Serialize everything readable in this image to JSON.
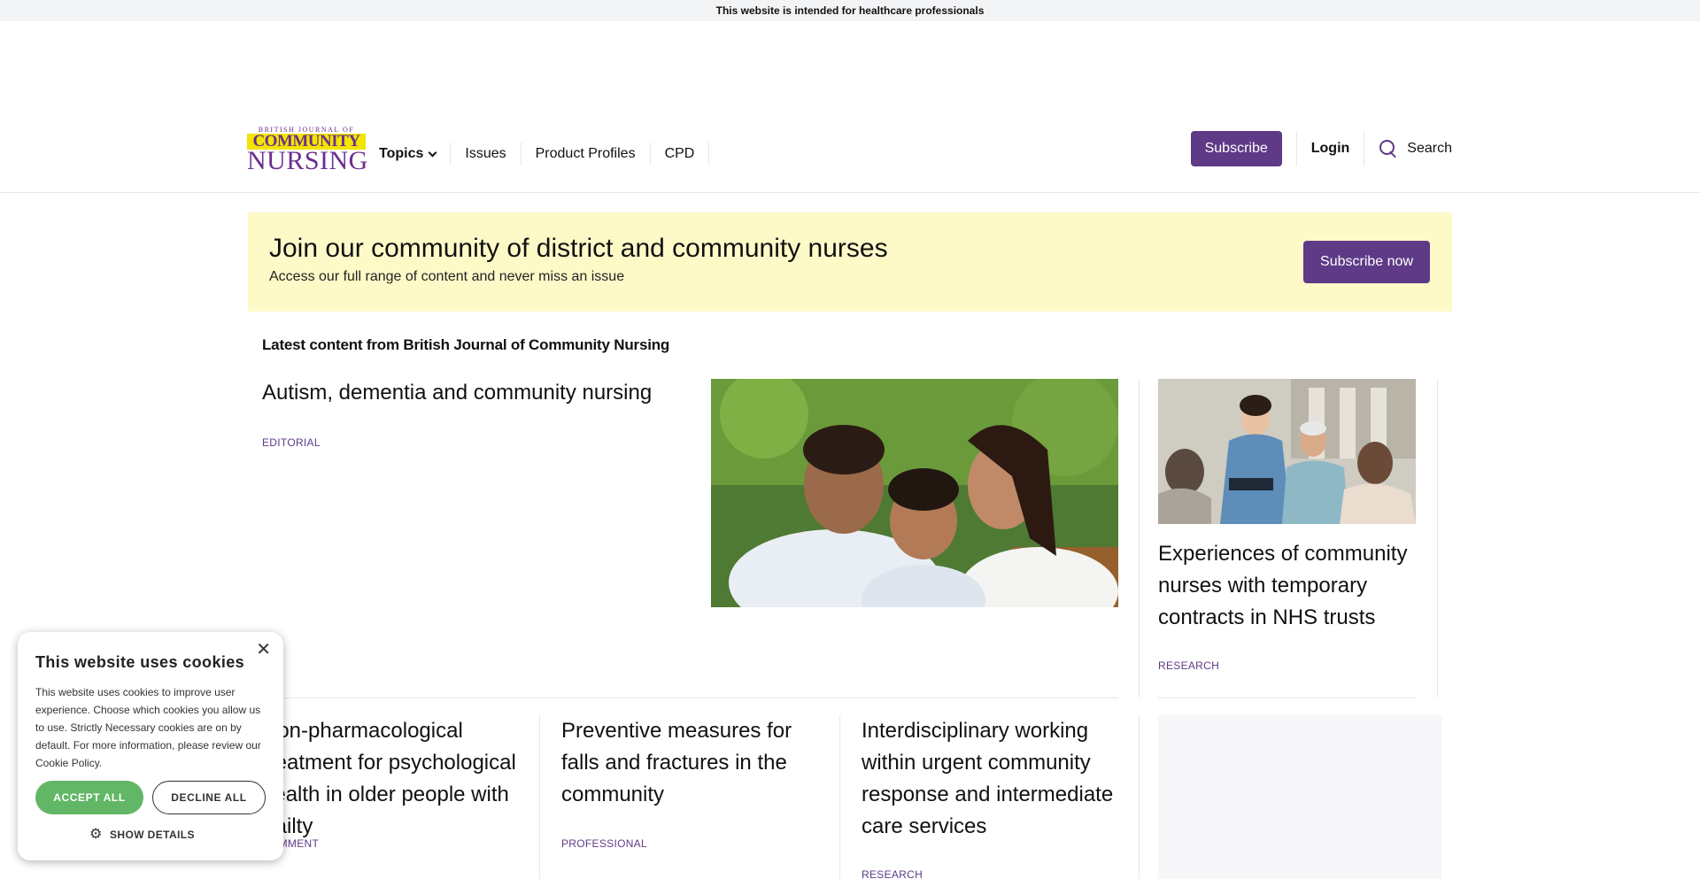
{
  "topbar": {
    "notice": "This website is intended for healthcare professionals"
  },
  "header": {
    "logo": {
      "line1": "BRITISH JOURNAL OF",
      "line2": "COMMUNITY",
      "line3": "NURSING"
    },
    "nav": [
      {
        "label": "Topics"
      },
      {
        "label": "Issues"
      },
      {
        "label": "Product Profiles"
      },
      {
        "label": "CPD"
      }
    ],
    "subscribe_label": "Subscribe",
    "login_label": "Login",
    "search_label": "Search"
  },
  "promo": {
    "title": "Join our community of district and community nurses",
    "subtitle": "Access our full range of content and never miss an issue",
    "button": "Subscribe now"
  },
  "latest": {
    "heading": "Latest content from British Journal of Community Nursing"
  },
  "featured": {
    "title": "Autism, dementia and community nursing",
    "tag": "EDITORIAL"
  },
  "side_article": {
    "title": "Experiences of community nurses with temporary contracts in NHS trusts",
    "tag": "RESEARCH"
  },
  "cards": [
    {
      "title": "Non-pharmacological treatment for psychological health in older people with frailty",
      "tag": "COMMENT"
    },
    {
      "title": "Preventive measures for falls and fractures in the community",
      "tag": "PROFESSIONAL"
    },
    {
      "title": "Interdisciplinary working within urgent community response and intermediate care services",
      "tag": "RESEARCH"
    }
  ],
  "cookie": {
    "title": "This website uses cookies",
    "close": "✕",
    "body": "This website uses cookies to improve user experience. Choose which cookies you allow us to use. Strictly Necessary cookies are on by default. For more information, please review our Cookie Policy.",
    "accept": "ACCEPT ALL",
    "decline": "DECLINE ALL",
    "show_details": "SHOW DETAILS"
  },
  "colors": {
    "brand_purple": "#5e3a87",
    "promo_bg": "#fefac8",
    "accept_green": "#61b765"
  }
}
